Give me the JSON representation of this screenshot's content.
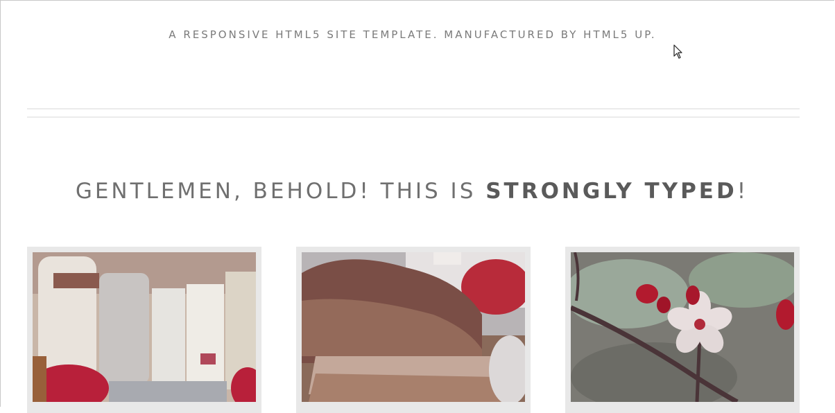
{
  "header": {
    "tagline": "A responsive HTML5 site template. Manufactured by HTML5 UP."
  },
  "banner": {
    "prefix": "GENTLEMEN, BEHOLD! THIS IS ",
    "emphasis": "STRONGLY TYPED",
    "suffix": "!"
  },
  "features": {
    "images": [
      {
        "icon": "books-image"
      },
      {
        "icon": "chocolate-toast-image"
      },
      {
        "icon": "cherry-blossom-image"
      }
    ]
  }
}
